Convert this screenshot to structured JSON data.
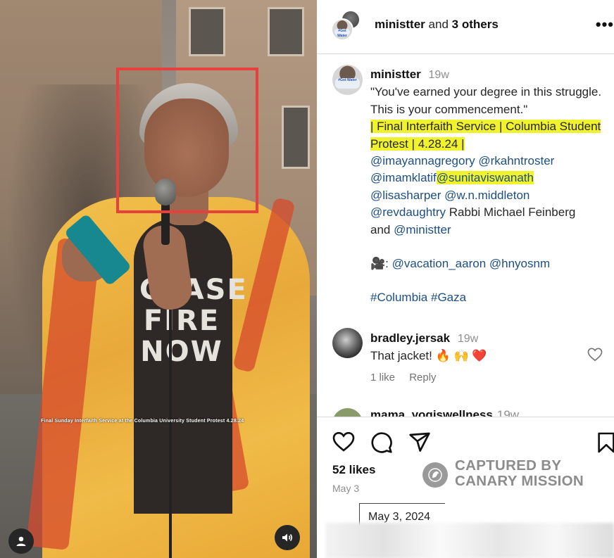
{
  "media": {
    "caption": "Final Sunday Interfaith Service at the Columbia University Student Protest 4.28.24",
    "shirt_text": "CEASE FIRE NOW",
    "icons": [
      "user-icon",
      "speaker-icon"
    ]
  },
  "header": {
    "owner": "ministter",
    "co_authors": "and",
    "others": "3 others",
    "more_label": "•••",
    "avatar_mask_text": "#Got Water"
  },
  "post": {
    "username": "ministter",
    "time": "19w",
    "line_quote": "\"You've earned your degree in this struggle. This is your commencement.\"",
    "line_title": "| Final Interfaith Service | Columbia Student Protest | 4.28.24 |",
    "mentions_1": [
      "@imayannagregory",
      "@rkahntroster"
    ],
    "mention_imam": "@imamklatif",
    "mention_highlight": "@sunitaviswanath",
    "mentions_3": [
      "@lisasharper",
      "@w.n.middleton"
    ],
    "mention_rev": "@revdaughtry",
    "rabbi_text": "Rabbi Michael Feinberg",
    "and_text": "and",
    "mention_ministter": "@ministter",
    "camera_emoji": "🎥",
    "camera_sep": ":",
    "camera_mentions": [
      "@vacation_aaron",
      "@hnyosnm"
    ],
    "hashtags": [
      "#Columbia",
      "#Gaza"
    ]
  },
  "comment": {
    "username": "bradley.jersak",
    "time": "19w",
    "text": "That jacket!",
    "emojis": "🔥 🙌 ❤️",
    "likes": "1 like",
    "reply": "Reply"
  },
  "comment2": {
    "username": "mama_yogiswellness",
    "time": "19w"
  },
  "actions": {
    "likes": "52 likes",
    "date": "May 3"
  },
  "watermark": {
    "line1": "CAPTURED BY",
    "line2": "CANARY MISSION"
  },
  "stamp": {
    "date": "May 3, 2024"
  },
  "colors": {
    "highlight": "#f1f22e",
    "mention": "#1d4f82",
    "annotation_box": "#e8413d"
  }
}
